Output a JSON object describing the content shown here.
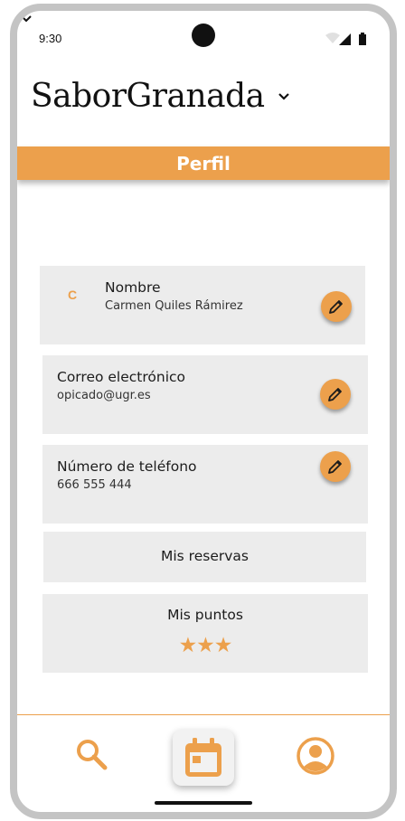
{
  "status_bar": {
    "time": "9:30"
  },
  "header": {
    "app_title": "SaborGranada"
  },
  "section": {
    "title": "Perfil"
  },
  "profile": {
    "name_card": {
      "initial": "C",
      "label": "Nombre",
      "value": "Carmen Quiles Rámirez"
    },
    "email_card": {
      "label": "Correo electrónico",
      "value": "opicado@ugr.es"
    },
    "phone_card": {
      "label": "Número de teléfono",
      "value": "666 555 444"
    },
    "reservations": {
      "label": "Mis reservas"
    },
    "points": {
      "label": "Mis puntos",
      "stars_display": "★★★",
      "stars": 3
    }
  },
  "bottom_nav": {
    "items": [
      "search-icon",
      "calendar-icon",
      "account-circle-icon"
    ],
    "active": "calendar-icon"
  },
  "colors": {
    "accent": "#eca04c",
    "card": "#ececec",
    "frame": "#c4c4c4",
    "text": "#1c1c1c"
  },
  "icons": [
    "chevron-down-icon",
    "wifi-icon",
    "signal-icon",
    "battery-icon",
    "pencil-icon"
  ]
}
